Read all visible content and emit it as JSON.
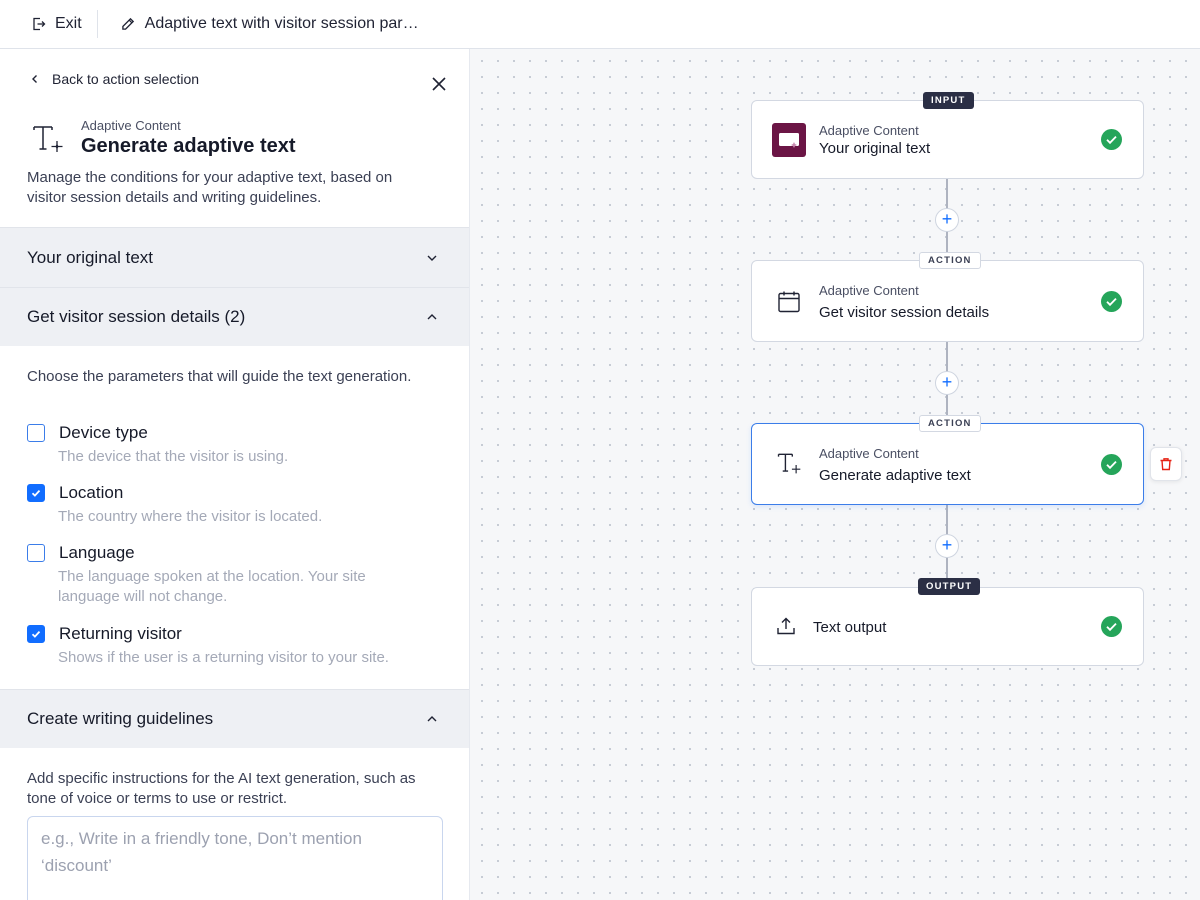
{
  "topbar": {
    "exit_label": "Exit",
    "title": "Adaptive text with visitor session par…"
  },
  "panel": {
    "back_label": "Back to action selection",
    "header_sub": "Adaptive Content",
    "header_title": "Generate adaptive text",
    "description": "Manage the conditions for your adaptive text, based on visitor session details and writing guidelines.",
    "sections": [
      {
        "label": "Your original text",
        "expanded": false
      },
      {
        "label": "Get visitor session details (2)",
        "expanded": true
      },
      {
        "label": "Create writing guidelines",
        "expanded": true
      }
    ],
    "session_intro": "Choose the parameters that will guide the text generation.",
    "options": [
      {
        "label": "Device type",
        "description": "The device that the visitor is using.",
        "checked": false
      },
      {
        "label": "Location",
        "description": "The country where the visitor is located.",
        "checked": true
      },
      {
        "label": "Language",
        "description": "The language spoken at the location. Your site language will not change.",
        "checked": false
      },
      {
        "label": "Returning visitor",
        "description": "Shows if the user is a returning visitor to your site.",
        "checked": true
      }
    ],
    "guidelines_intro": "Add specific instructions for the AI text generation, such as tone of voice or terms to use or restrict.",
    "guidelines_placeholder": "e.g., Write in a friendly tone, Don’t mention ‘discount’",
    "guidelines_value": ""
  },
  "flow": {
    "nodes": [
      {
        "badge": "INPUT",
        "sub": "Adaptive Content",
        "title": "Your original text",
        "icon": "image-sparkle-icon",
        "status": "complete"
      },
      {
        "badge": "ACTION",
        "sub": "Adaptive Content",
        "title": "Get visitor session details",
        "icon": "calendar-icon",
        "status": "complete"
      },
      {
        "badge": "ACTION",
        "sub": "Adaptive Content",
        "title": "Generate adaptive text",
        "icon": "text-sparkle-icon",
        "status": "complete",
        "selected": true
      },
      {
        "badge": "OUTPUT",
        "sub": "",
        "title": "Text output",
        "icon": "upload-icon",
        "status": "complete"
      }
    ],
    "add_step_symbol": "+"
  },
  "colors": {
    "accent": "#116dff",
    "success": "#25a55a",
    "danger": "#e62214",
    "brand_tile": "#6b1545",
    "badge_dark": "#2b2f45"
  }
}
